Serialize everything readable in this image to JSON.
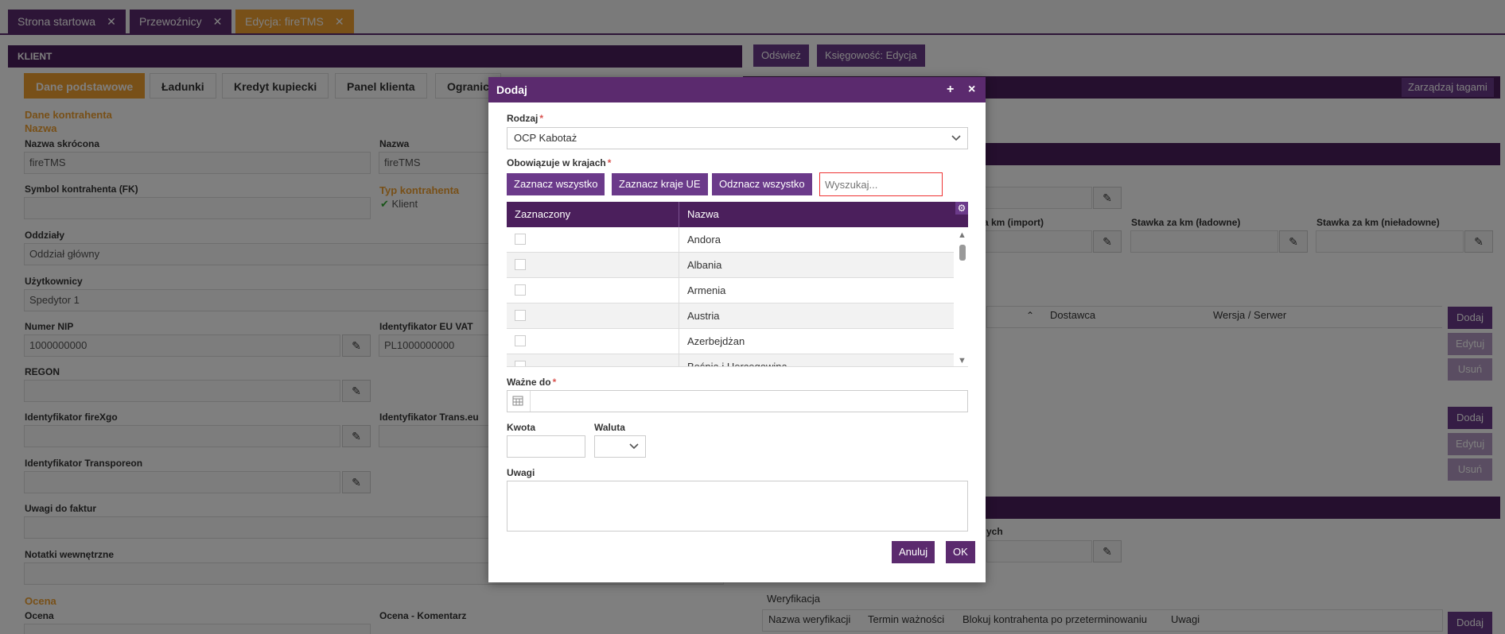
{
  "top_tabs": [
    {
      "label": "Strona startowa",
      "close": "✕"
    },
    {
      "label": "Przewoźnicy",
      "close": "✕"
    },
    {
      "label": "Edycja: fireTMS",
      "close": "✕"
    }
  ],
  "left_panel": {
    "title": "KLIENT",
    "tabs": [
      "Dane podstawowe",
      "Ładunki",
      "Kredyt kupiecki",
      "Panel klienta",
      "Ogranic"
    ],
    "section_dane": "Dane kontrahenta",
    "section_nazwa": "Nazwa",
    "labels": {
      "nazwa_skrocona": "Nazwa skrócona",
      "nazwa": "Nazwa",
      "symbol": "Symbol kontrahenta (FK)",
      "oddzialy": "Oddziały",
      "uzytkownicy": "Użytkownicy",
      "nip": "Numer NIP",
      "eu_vat": "Identyfikator EU VAT",
      "regon": "REGON",
      "firexgo": "Identyfikator fireXgo",
      "transeu": "Identyfikator Trans.eu",
      "transporeon": "Identyfikator Transporeon",
      "uwagi_faktur": "Uwagi do faktur",
      "notatki": "Notatki wewnętrzne",
      "ocena_section": "Ocena",
      "ocena": "Ocena",
      "ocena_kom": "Ocena - Komentarz",
      "typ": "Typ kontrahenta"
    },
    "values": {
      "nazwa_skrocona": "fireTMS",
      "nazwa": "fireTMS",
      "typ": "Klient",
      "oddzialy": "Oddział główny",
      "uzytkownicy": "Spedytor 1",
      "nip": "1000000000",
      "eu_vat": "PL1000000000"
    }
  },
  "right_panel": {
    "buttons": {
      "odswiez": "Odśwież",
      "ksiegowosc": "Księgowość: Edycja",
      "tagi": "Zarządzaj tagami"
    },
    "labels": {
      "km_import": "a km (import)",
      "km_ladowne": "Stawka za km (ładowne)",
      "km_nieladowne": "Stawka za km (nieładowne)",
      "dostawca": "Dostawca",
      "wersja": "Wersja / Serwer",
      "ych": "ych",
      "weryfikacja": "Weryfikacja",
      "nazwa_weryf": "Nazwa weryfikacji",
      "termin": "Termin ważności",
      "blokuj": "Blokuj kontrahenta po przeterminowaniu",
      "uwagi": "Uwagi"
    },
    "side_buttons": {
      "dodaj": "Dodaj",
      "edytuj": "Edytuj",
      "usun": "Usuń"
    }
  },
  "modal": {
    "title": "Dodaj",
    "plus_icon": "+",
    "close_icon": "×",
    "rodzaj_label": "Rodzaj",
    "required_mark": "*",
    "rodzaj_value": "OCP Kabotaż",
    "kraje_label": "Obowiązuje w krajach",
    "btn_all": "Zaznacz wszystko",
    "btn_eu": "Zaznacz kraje UE",
    "btn_none": "Odznacz wszystko",
    "search_placeholder": "Wyszukaj...",
    "grid_headers": [
      "Zaznaczony",
      "Nazwa"
    ],
    "countries": [
      "Andora",
      "Albania",
      "Armenia",
      "Austria",
      "Azerbejdżan",
      "Bośnia i Hercegowina"
    ],
    "wazne_label": "Ważne do",
    "kwota_label": "Kwota",
    "waluta_label": "Waluta",
    "uwagi_label": "Uwagi",
    "btn_cancel": "Anuluj",
    "btn_ok": "OK"
  }
}
